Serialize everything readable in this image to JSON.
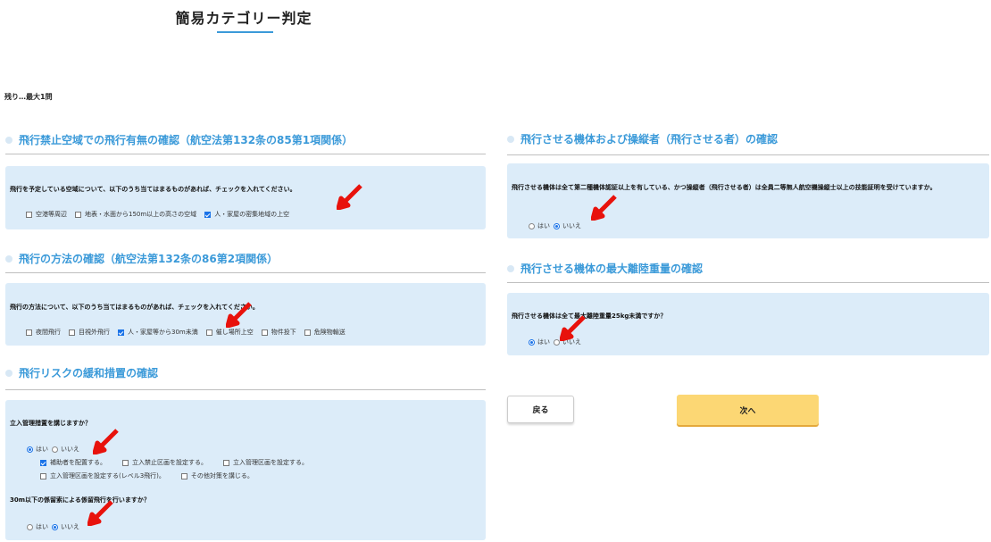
{
  "page": {
    "title": "簡易カテゴリー判定",
    "remaining": "残り…最大1問",
    "accent_color": "#3b9ad9",
    "box_color": "#dcecf9"
  },
  "sections": {
    "airspace": {
      "heading": "飛行禁止空域での飛行有無の確認（航空法第132条の85第1項関係）",
      "question": "飛行を予定している空域について、以下のうち当てはまるものがあれば、チェックを入れてください。",
      "options": [
        {
          "label": "空港等周辺",
          "checked": false
        },
        {
          "label": "地表・水面から150m以上の高さの空域",
          "checked": false
        },
        {
          "label": "人・家屋の密集地域の上空",
          "checked": true
        }
      ]
    },
    "method": {
      "heading": "飛行の方法の確認（航空法第132条の86第2項関係）",
      "question": "飛行の方法について、以下のうち当てはまるものがあれば、チェックを入れてください。",
      "options": [
        {
          "label": "夜間飛行",
          "checked": false
        },
        {
          "label": "目視外飛行",
          "checked": false
        },
        {
          "label": "人・家屋等から30m未満",
          "checked": true
        },
        {
          "label": "催し場所上空",
          "checked": false
        },
        {
          "label": "物件投下",
          "checked": false
        },
        {
          "label": "危険物輸送",
          "checked": false
        }
      ]
    },
    "risk": {
      "heading": "飛行リスクの緩和措置の確認",
      "question1": "立入管理措置を講じますか？",
      "q1_yes": "はい",
      "q1_no": "いいえ",
      "q1_selected": "yes",
      "measures": [
        {
          "label": "補助者を配置する。",
          "checked": true
        },
        {
          "label": "立入禁止区画を設定する。",
          "checked": false
        },
        {
          "label": "立入管理区画を設定する。",
          "checked": false
        },
        {
          "label": "立入管理区画を設定する(レベル3飛行)。",
          "checked": false
        },
        {
          "label": "その他対策を講じる。",
          "checked": false
        }
      ],
      "question2": "30m以下の係留索による係留飛行を行いますか？",
      "q2_yes": "はい",
      "q2_no": "いいえ",
      "q2_selected": "no"
    },
    "aircraft": {
      "heading": "飛行させる機体および操縦者（飛行させる者）の確認",
      "question": "飛行させる機体は全て第二種機体認証以上を有している、かつ操縦者（飛行させる者）は全員二等無人航空機操縦士以上の技能証明を受けていますか。",
      "yes": "はい",
      "no": "いいえ",
      "selected": "no"
    },
    "weight": {
      "heading": "飛行させる機体の最大離陸重量の確認",
      "question": "飛行させる機体は全て最大離陸重量25kg未満ですか？",
      "yes": "はい",
      "no": "いいえ",
      "selected": "yes"
    }
  },
  "buttons": {
    "back": "戻る",
    "next": "次へ",
    "next_color": "#fcd774"
  },
  "annotation": {
    "arrow_icon": "red-arrow-icon",
    "arrow_color": "#e8120c"
  }
}
